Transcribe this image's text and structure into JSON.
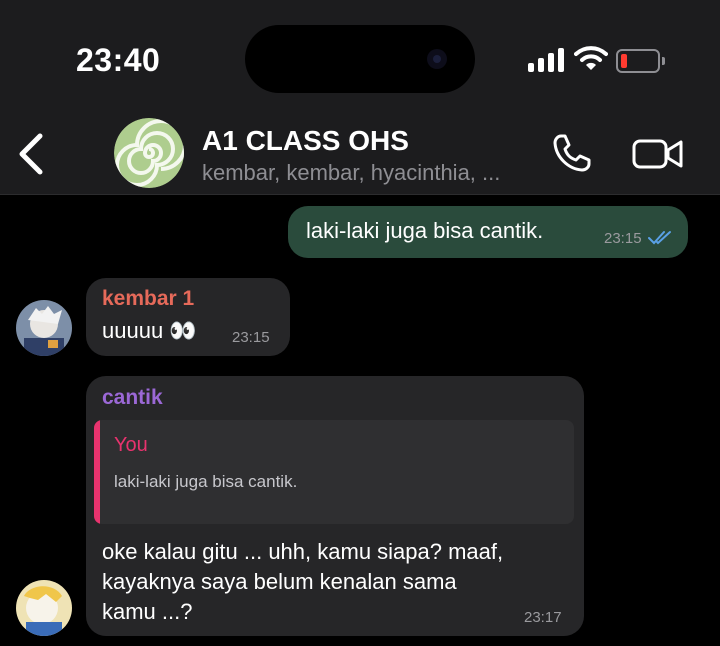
{
  "status_bar": {
    "time": "23:40"
  },
  "header": {
    "title": "A1 CLASS OHS",
    "members": "kembar, kembar, hyacinthia, ...",
    "back_icon": "chevron-left-icon",
    "call_icon": "phone-icon",
    "video_icon": "video-camera-icon"
  },
  "colors": {
    "outgoing_bubble": "#2a4b3c",
    "incoming_bubble": "#262628",
    "sender_kembar": "#e66a5a",
    "sender_cantik": "#9b68d6",
    "reply_accent": "#e8336e",
    "read_ticks": "#5aa0e6"
  },
  "messages": [
    {
      "direction": "outgoing",
      "text": "laki-laki juga bisa cantik.",
      "time": "23:15",
      "status": "read"
    },
    {
      "direction": "incoming",
      "sender": "kembar 1",
      "text": "uuuuu 👀",
      "time": "23:15"
    },
    {
      "direction": "incoming",
      "sender": "cantik",
      "reply_to": {
        "author": "You",
        "text": "laki-laki juga bisa cantik."
      },
      "lines": [
        "oke kalau gitu ... uhh, kamu siapa? maaf,",
        "kayaknya saya belum kenalan sama",
        "kamu ...?"
      ],
      "time": "23:17"
    }
  ]
}
